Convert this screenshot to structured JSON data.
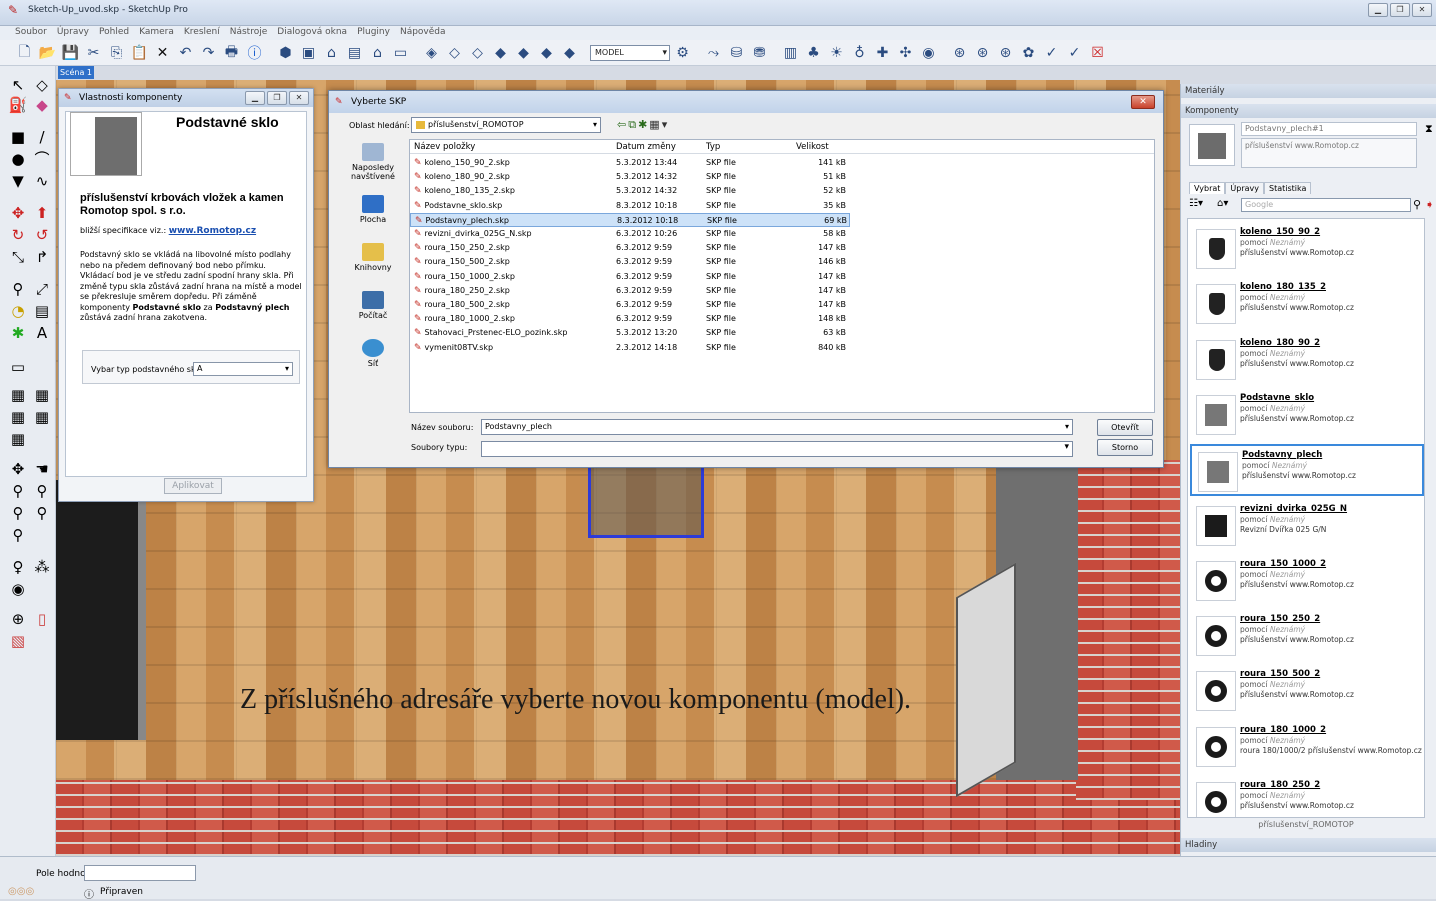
{
  "window": {
    "title": "Sketch-Up_uvod.skp - SketchUp Pro"
  },
  "menu": [
    "Soubor",
    "Úpravy",
    "Pohled",
    "Kamera",
    "Kreslení",
    "Nástroje",
    "Dialogová okna",
    "Pluginy",
    "Nápověda"
  ],
  "toolbar": {
    "mode_select": "MODEL"
  },
  "scene_tab": "Scéna 1",
  "caption": "Z příslušného adresáře vyberte novou komponentu (model).",
  "props": {
    "title": "Vlastnosti komponenty",
    "name": "Podstavné sklo",
    "heading": "příslušenství krbovách vložek a kamen Romotop spol. s r.o.",
    "more_prefix": "bližší specifikace viz.:",
    "more_link": "www.Romotop.cz",
    "text1": "Podstavný sklo se vkládá na libovolné místo podlahy nebo na předem definovaný bod nebo přímku. Vkládací bod je ve středu zadní spodní hrany skla. Při změně typu skla zůstává zadní hrana na místě a model se překresluje směrem dopředu. Při záměně komponenty ",
    "text_b1": "Podstavné sklo",
    "text2": " za ",
    "text_b2": "Podstavný plech",
    "text3": " zůstává zadní hrana zakotvena.",
    "type_label": "Vybar typ podstavného skla",
    "type_value": "A",
    "apply": "Aplikovat"
  },
  "dialog": {
    "title": "Vyberte SKP",
    "look_in_label": "Oblast hledání:",
    "look_in_value": "příslušenství_ROMOTOP",
    "places": [
      "Naposledy navštívené",
      "Plocha",
      "Knihovny",
      "Počítač",
      "Síť"
    ],
    "columns": [
      "Název položky",
      "Datum změny",
      "Typ",
      "Velikost"
    ],
    "files": [
      {
        "name": "koleno_150_90_2.skp",
        "date": "5.3.2012 13:44",
        "type": "SKP file",
        "size": "141 kB"
      },
      {
        "name": "koleno_180_90_2.skp",
        "date": "5.3.2012 14:32",
        "type": "SKP file",
        "size": "51 kB"
      },
      {
        "name": "koleno_180_135_2.skp",
        "date": "5.3.2012 14:32",
        "type": "SKP file",
        "size": "52 kB"
      },
      {
        "name": "Podstavne_sklo.skp",
        "date": "8.3.2012 10:18",
        "type": "SKP file",
        "size": "35 kB"
      },
      {
        "name": "Podstavny_plech.skp",
        "date": "8.3.2012 10:18",
        "type": "SKP file",
        "size": "69 kB"
      },
      {
        "name": "revizni_dvirka_025G_N.skp",
        "date": "6.3.2012 10:26",
        "type": "SKP file",
        "size": "58 kB"
      },
      {
        "name": "roura_150_250_2.skp",
        "date": "6.3.2012 9:59",
        "type": "SKP file",
        "size": "147 kB"
      },
      {
        "name": "roura_150_500_2.skp",
        "date": "6.3.2012 9:59",
        "type": "SKP file",
        "size": "146 kB"
      },
      {
        "name": "roura_150_1000_2.skp",
        "date": "6.3.2012 9:59",
        "type": "SKP file",
        "size": "147 kB"
      },
      {
        "name": "roura_180_250_2.skp",
        "date": "6.3.2012 9:59",
        "type": "SKP file",
        "size": "147 kB"
      },
      {
        "name": "roura_180_500_2.skp",
        "date": "6.3.2012 9:59",
        "type": "SKP file",
        "size": "147 kB"
      },
      {
        "name": "roura_180_1000_2.skp",
        "date": "6.3.2012 9:59",
        "type": "SKP file",
        "size": "148 kB"
      },
      {
        "name": "Stahovaci_Prstenec-ELO_pozink.skp",
        "date": "5.3.2012 13:20",
        "type": "SKP file",
        "size": "63 kB"
      },
      {
        "name": "vymenit08TV.skp",
        "date": "2.3.2012 14:18",
        "type": "SKP file",
        "size": "840 kB"
      }
    ],
    "selected_index": 4,
    "filename_label": "Název souboru:",
    "filename_value": "Podstavny_plech",
    "filetype_label": "Soubory typu:",
    "open": "Otevřít",
    "cancel": "Storno"
  },
  "right_panel": {
    "materials": "Materiály",
    "components": "Komponenty",
    "comp_name": "Podstavny_plech#1",
    "comp_desc": "příslušenství www.Romotop.cz",
    "tabs": [
      "Vybrat",
      "Úpravy",
      "Statistika"
    ],
    "search_placeholder": "Google",
    "by": "pomocí",
    "by_unknown": "Neznámý",
    "items": [
      {
        "name": "koleno_150_90_2",
        "desc": "příslušenství www.Romotop.cz",
        "shape": "pipe"
      },
      {
        "name": "koleno_180_135_2",
        "desc": "příslušenství www.Romotop.cz",
        "shape": "pipe"
      },
      {
        "name": "koleno_180_90_2",
        "desc": "příslušenství www.Romotop.cz",
        "shape": "pipe"
      },
      {
        "name": "Podstavne_sklo",
        "desc": "příslušenství www.Romotop.cz",
        "shape": "square"
      },
      {
        "name": "Podstavny_plech",
        "desc": "příslušenství www.Romotop.cz",
        "shape": "square"
      },
      {
        "name": "revizni_dvirka_025G_N",
        "desc": "Revizní Dvířka 025 G/N",
        "shape": "door"
      },
      {
        "name": "roura_150_1000_2",
        "desc": "příslušenství www.Romotop.cz",
        "shape": "ring"
      },
      {
        "name": "roura_150_250_2",
        "desc": "příslušenství www.Romotop.cz",
        "shape": "ring"
      },
      {
        "name": "roura_150_500_2",
        "desc": "příslušenství www.Romotop.cz",
        "shape": "ring"
      },
      {
        "name": "roura_180_1000_2",
        "desc": "roura 180/1000/2 příslušenství www.Romotop.cz",
        "shape": "ring"
      },
      {
        "name": "roura_180_250_2",
        "desc": "příslušenství www.Romotop.cz",
        "shape": "ring"
      }
    ],
    "selected_item": 4,
    "footer": "příslušenství_ROMOTOP",
    "layers": "Hladiny"
  },
  "vcb_label": "Pole hodnot",
  "status": "Připraven"
}
